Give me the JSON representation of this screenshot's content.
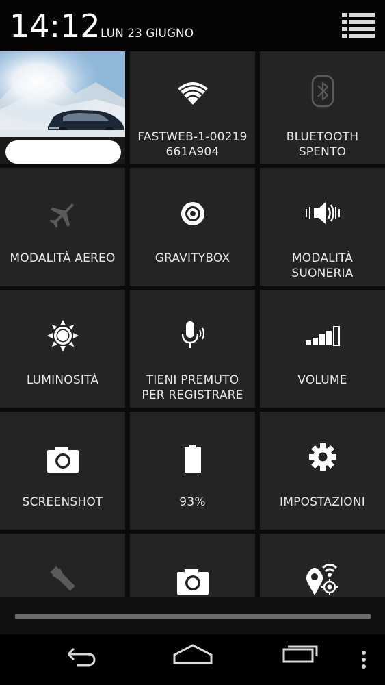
{
  "status": {
    "clock": "14:12",
    "date": "LUN 23 GIUGNO"
  },
  "header_icons": [
    "list-view-icon"
  ],
  "tiles": [
    {
      "id": "user",
      "label": ""
    },
    {
      "id": "wifi",
      "label_line1": "FASTWEB-1-00219",
      "label_line2": "661A904",
      "icon": "wifi-icon",
      "enabled": true
    },
    {
      "id": "bluetooth",
      "label_line1": "BLUETOOTH",
      "label_line2": "SPENTO",
      "icon": "bluetooth-icon",
      "enabled": false
    },
    {
      "id": "airplane",
      "label_line1": "MODALITÀ AEREO",
      "icon": "airplane-icon",
      "enabled": false
    },
    {
      "id": "gravitybox",
      "label_line1": "GRAVITYBOX",
      "icon": "gear-circle-icon",
      "enabled": true
    },
    {
      "id": "ringer",
      "label_line1": "MODALITÀ",
      "label_line2": "SUONERIA",
      "icon": "speaker-vibrate-icon",
      "enabled": true
    },
    {
      "id": "brightness",
      "label_line1": "LUMINOSITÀ",
      "icon": "sun-icon",
      "enabled": true
    },
    {
      "id": "voice",
      "label_line1": "TIENI PREMUTO",
      "label_line2": "PER REGISTRARE",
      "icon": "microphone-icon",
      "enabled": true
    },
    {
      "id": "volume",
      "label_line1": "VOLUME",
      "icon": "volume-bars-icon",
      "enabled": true
    },
    {
      "id": "screenshot",
      "label_line1": "SCREENSHOT",
      "icon": "camera-icon",
      "enabled": true
    },
    {
      "id": "battery",
      "label_line1": "93%",
      "icon": "battery-icon",
      "enabled": true
    },
    {
      "id": "settings",
      "label_line1": "IMPOSTAZIONI",
      "icon": "settings-icon",
      "enabled": true
    },
    {
      "id": "torch",
      "label_line1": "",
      "icon": "flashlight-icon",
      "enabled": false
    },
    {
      "id": "camera",
      "label_line1": "",
      "icon": "camera-icon",
      "enabled": true
    },
    {
      "id": "location",
      "label_line1": "",
      "icon": "location-wifi-icon",
      "enabled": true
    }
  ],
  "navbar": {
    "buttons": [
      "back-icon",
      "home-icon",
      "recents-icon",
      "overflow-menu-icon"
    ]
  }
}
